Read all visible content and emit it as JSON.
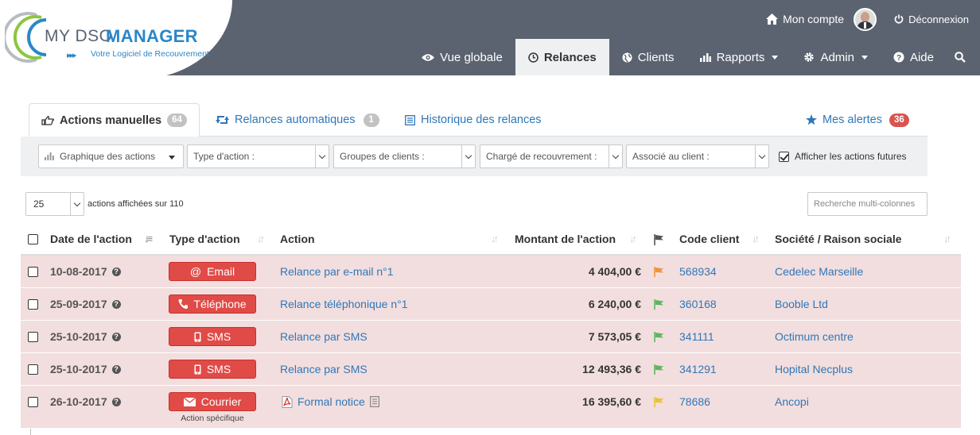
{
  "brand": {
    "name_part1": "MY DSO",
    "name_part2": "MANAGER",
    "tagline": "Votre Logiciel de Recouvrement",
    "colors": {
      "blue": "#2b87c9",
      "green": "#8dc63f",
      "grey": "#5a6472"
    }
  },
  "top_links": {
    "account": "Mon compte",
    "logout": "Déconnexion"
  },
  "nav": {
    "items": [
      {
        "label": "Vue globale",
        "icon": "eye-icon"
      },
      {
        "label": "Relances",
        "icon": "clock-icon",
        "active": true
      },
      {
        "label": "Clients",
        "icon": "globe-icon"
      },
      {
        "label": "Rapports",
        "icon": "bar-chart-icon",
        "dropdown": true
      },
      {
        "label": "Admin",
        "icon": "gear-icon",
        "dropdown": true
      },
      {
        "label": "Aide",
        "icon": "question-icon"
      }
    ],
    "header_bg": "#5c6370"
  },
  "tabs": [
    {
      "label": "Actions manuelles",
      "badge": "64",
      "icon": "hand-pointer-icon",
      "active": true
    },
    {
      "label": "Relances automatiques",
      "badge": "1",
      "icon": "retweet-icon"
    },
    {
      "label": "Historique des relances",
      "icon": "list-icon"
    },
    {
      "label": "Mes alertes",
      "badge": "36",
      "icon": "star-icon"
    }
  ],
  "filters": {
    "chart_button": "Graphique des actions",
    "type": "Type d'action :",
    "groups": "Groupes de clients :",
    "owner": "Chargé de recouvrement :",
    "client": "Associé au client :",
    "future_label": "Afficher les actions futures",
    "future_checked": true
  },
  "table_controls": {
    "page_length": "25",
    "count_text": "actions affichées sur 110",
    "search_placeholder": "Recherche multi-colonnes"
  },
  "columns": {
    "date": "Date de l'action",
    "type": "Type d'action",
    "action": "Action",
    "amount": "Montant de l'action",
    "code": "Code client",
    "company": "Société / Raison sociale"
  },
  "rows": [
    {
      "date": "10-08-2017",
      "type": "Email",
      "type_icon": "at-icon",
      "action": "Relance par e-mail n°1",
      "amount": "4 404,00 €",
      "flag_color": "#f0953b",
      "code": "568934",
      "company": "Cedelec Marseille"
    },
    {
      "date": "25-09-2017",
      "type": "Téléphone",
      "type_icon": "phone-icon",
      "action": "Relance téléphonique n°1",
      "amount": "6 240,00 €",
      "flag_color": "#5cb85c",
      "code": "360168",
      "company": "Booble Ltd"
    },
    {
      "date": "25-10-2017",
      "type": "SMS",
      "type_icon": "mobile-icon",
      "action": "Relance par SMS",
      "amount": "7 573,05 €",
      "flag_color": "#5cb85c",
      "code": "341111",
      "company": "Octimum centre"
    },
    {
      "date": "25-10-2017",
      "type": "SMS",
      "type_icon": "mobile-icon",
      "action": "Relance par SMS",
      "amount": "12 493,36 €",
      "flag_color": "#5cb85c",
      "code": "341291",
      "company": "Hopital Necplus"
    },
    {
      "date": "26-10-2017",
      "type": "Courrier",
      "type_icon": "envelope-icon",
      "sub": "Action spécifique",
      "action": "Formal notice",
      "action_icon": "pdf-icon",
      "amount": "16 395,60 €",
      "flag_color": "#e8c23c",
      "code": "78686",
      "company": "Ancopi"
    }
  ],
  "row_bg": "#f2dede",
  "action_red": "#e04b47"
}
